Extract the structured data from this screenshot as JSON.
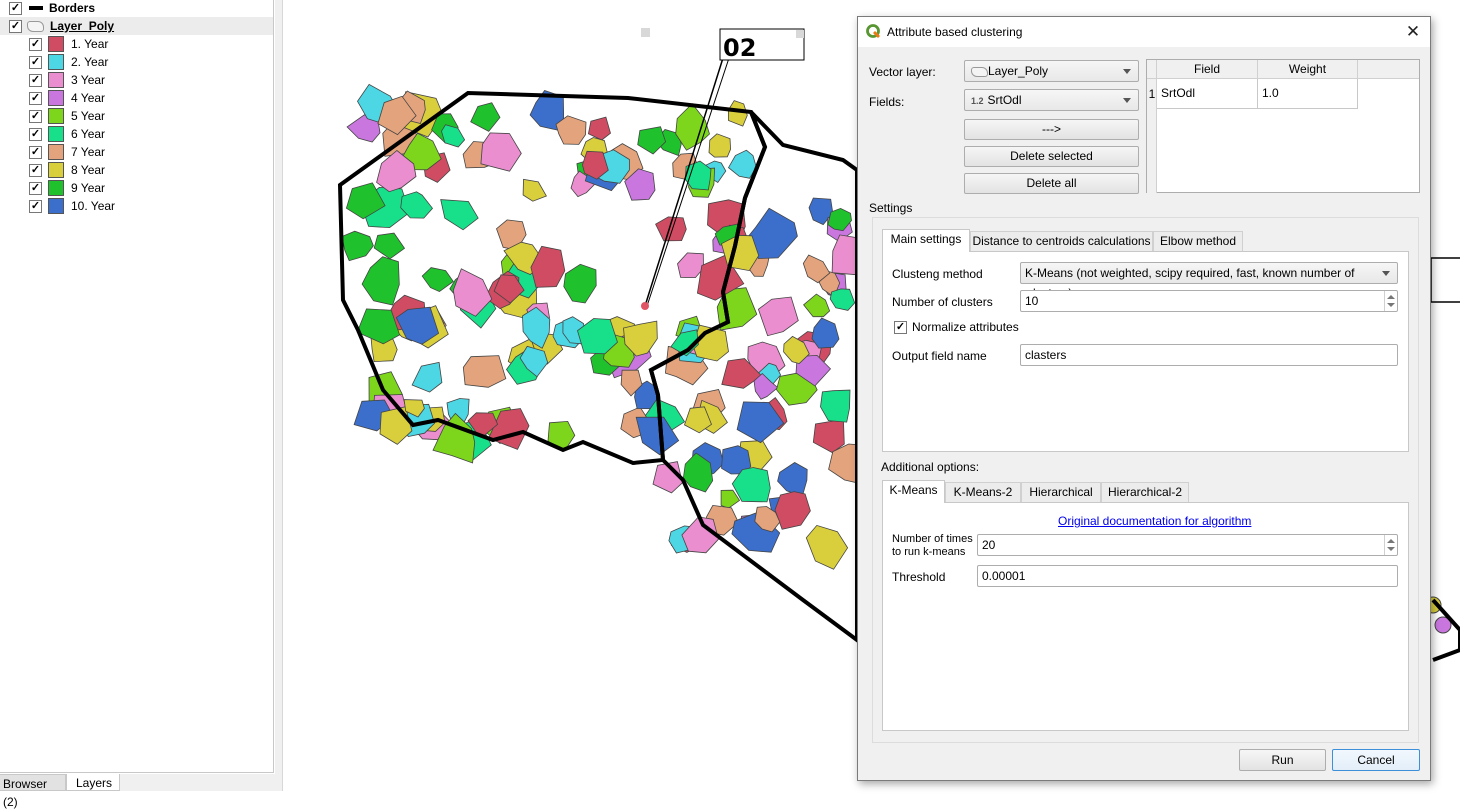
{
  "layers_panel": {
    "layers": [
      {
        "name": "Borders",
        "checked": true,
        "symbol": "line"
      },
      {
        "name": "Layer_Poly",
        "checked": true,
        "symbol": "polygon",
        "selected": true
      }
    ],
    "categories": [
      {
        "label": "1. Year",
        "color": "#d04c62",
        "checked": true
      },
      {
        "label": "2. Year",
        "color": "#4dd6e3",
        "checked": true
      },
      {
        "label": "3 Year",
        "color": "#ea8ecf",
        "checked": true
      },
      {
        "label": "4 Year",
        "color": "#c977df",
        "checked": true
      },
      {
        "label": "5 Year",
        "color": "#7dd61c",
        "checked": true
      },
      {
        "label": "6 Year",
        "color": "#18e08a",
        "checked": true
      },
      {
        "label": "7 Year",
        "color": "#e3a37c",
        "checked": true
      },
      {
        "label": "8 Year",
        "color": "#d9ce3c",
        "checked": true
      },
      {
        "label": "9 Year",
        "color": "#1fc22c",
        "checked": true
      },
      {
        "label": "10. Year",
        "color": "#3c6fcc",
        "checked": true
      }
    ],
    "bottom_tabs": [
      {
        "label": "Browser (2)",
        "active": false
      },
      {
        "label": "Layers",
        "active": true
      }
    ]
  },
  "map": {
    "label_text": "02"
  },
  "dialog": {
    "title": "Attribute based clustering",
    "vector_layer_label": "Vector layer:",
    "vector_layer_value": "Layer_Poly",
    "fields_label": "Fields:",
    "fields_type_badge": "1.2",
    "fields_value": "SrtOdl",
    "add_button": "--->",
    "delete_selected_button": "Delete selected",
    "delete_all_button": "Delete all",
    "table": {
      "headers": [
        "Field",
        "Weight"
      ],
      "rows": [
        {
          "index": "1",
          "field": "SrtOdl",
          "weight": "1.0"
        }
      ]
    },
    "settings_label": "Settings",
    "settings_tabs": [
      {
        "label": "Main settings",
        "active": true
      },
      {
        "label": "Distance to centroids calculations",
        "active": false
      },
      {
        "label": "Elbow method",
        "active": false
      }
    ],
    "main": {
      "method_label": "Clusteng method",
      "method_value": "K-Means (not weighted, scipy required, fast, known number of clusters)",
      "clusters_label": "Number of clusters",
      "clusters_value": "10",
      "normalize_label": "Normalize attributes",
      "normalize_checked": true,
      "output_label": "Output field name",
      "output_value": "clasters"
    },
    "additional_label": "Additional options:",
    "additional_tabs": [
      {
        "label": "K-Means",
        "active": true
      },
      {
        "label": "K-Means-2",
        "active": false
      },
      {
        "label": "Hierarchical",
        "active": false
      },
      {
        "label": "Hierarchical-2",
        "active": false
      }
    ],
    "kmeans": {
      "doc_link": "Original documentation for algorithm",
      "times_label_1": "Number of times",
      "times_label_2": "to run k-means",
      "times_value": "20",
      "threshold_label": "Threshold",
      "threshold_value": "0.00001"
    },
    "run_button": "Run",
    "cancel_button": "Cancel"
  }
}
